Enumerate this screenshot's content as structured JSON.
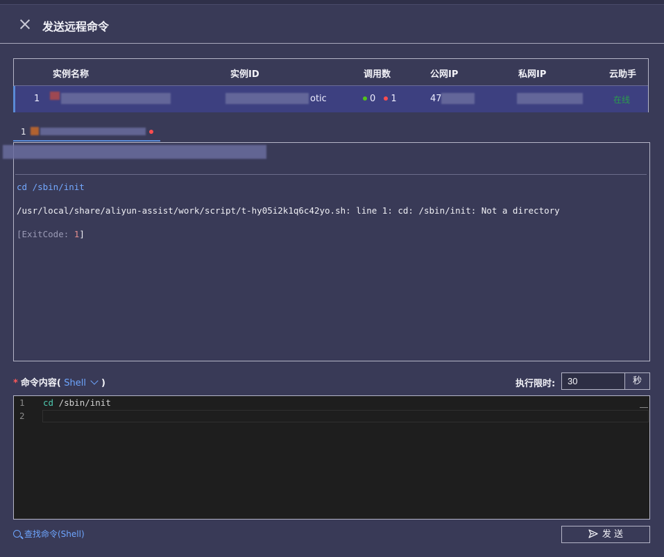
{
  "dialog": {
    "title": "发送远程命令"
  },
  "table": {
    "columns": [
      "实例名称",
      "实例ID",
      "调用数",
      "公网IP",
      "私网IP",
      "云助手"
    ],
    "row": {
      "index": "1",
      "id_suffix": "otic",
      "success_count": "0",
      "fail_count": "1",
      "public_ip_prefix": "47",
      "status": "在线"
    }
  },
  "instance_tab": {
    "index": "1"
  },
  "output": {
    "command": "cd /sbin/init",
    "error": "/usr/local/share/aliyun-assist/work/script/t-hy05i2k1q6c42yo.sh: line 1: cd: /sbin/init: Not a directory",
    "exit_prefix": "[ExitCode: ",
    "exit_code": "1",
    "exit_suffix": "]"
  },
  "command_form": {
    "label": "命令内容(",
    "label_end": ")",
    "shell": "Shell",
    "timeout_label": "执行限时:",
    "timeout_value": "30",
    "timeout_unit": "秒"
  },
  "editor": {
    "lines": [
      "1",
      "2"
    ],
    "code_cmd": "cd",
    "code_arg": " /sbin/init"
  },
  "footer": {
    "find_link": "查找命令(Shell)",
    "send_label": "发 送"
  },
  "colors": {
    "accent": "#6ea6ff",
    "success": "#2a9d4b",
    "error": "#ff5959",
    "background": "#393a57"
  }
}
